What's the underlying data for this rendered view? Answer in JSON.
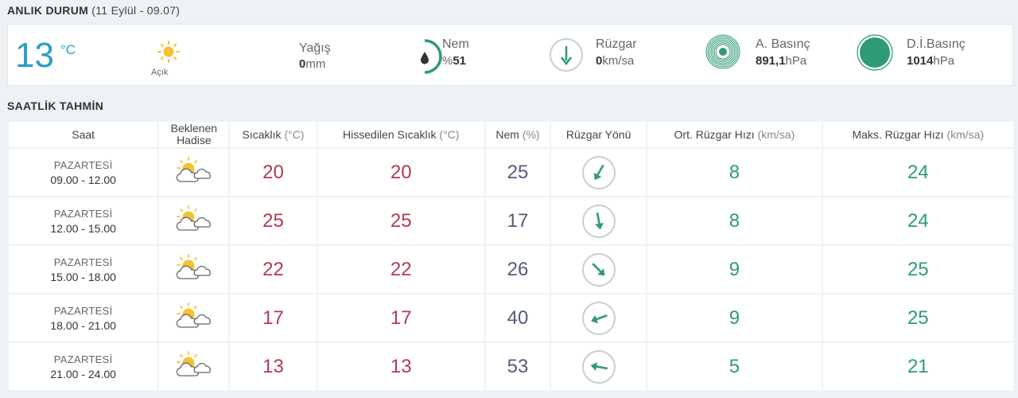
{
  "current": {
    "title": "ANLIK DURUM",
    "subtitle": "(11 Eylül - 09.07)",
    "temperature": "13",
    "temperature_unit": "°C",
    "condition_icon": "sun-icon",
    "condition": "Açık",
    "rain_label": "Yağış",
    "rain_value": "0",
    "rain_unit": "mm",
    "humidity_label": "Nem",
    "humidity_prefix": "%",
    "humidity_value": "51",
    "humidity_level": 0.51,
    "wind_label": "Rüzgar",
    "wind_value": "0",
    "wind_unit": "km/sa",
    "pressure_label": "A. Basınç",
    "pressure_value": "891,1",
    "pressure_unit": "hPa",
    "sea_pressure_label": "D.İ.Basınç",
    "sea_pressure_value": "1014",
    "sea_pressure_unit": "hPa"
  },
  "hourly": {
    "title": "SAATLİK TAHMİN",
    "headers": {
      "time": "Saat",
      "event_1": "Beklenen",
      "event_2": "Hadise",
      "temp": "Sıcaklık",
      "temp_unit": "(°C)",
      "feels": "Hissedilen Sıcaklık",
      "feels_unit": "(°C)",
      "humidity": "Nem",
      "humidity_unit": "(%)",
      "wind_dir": "Rüzgar Yönü",
      "wind_avg": "Ort. Rüzgar Hızı",
      "wind_avg_unit": "(km/sa)",
      "wind_max": "Maks. Rüzgar Hızı",
      "wind_max_unit": "(km/sa)"
    },
    "rows": [
      {
        "day": "PAZARTESİ",
        "range": "09.00 - 12.00",
        "icon": "partly-cloudy-icon",
        "temp": "20",
        "feels": "20",
        "humidity": "25",
        "wind_dir_deg": 30,
        "wind_avg": "8",
        "wind_max": "24"
      },
      {
        "day": "PAZARTESİ",
        "range": "12.00 - 15.00",
        "icon": "partly-cloudy-icon",
        "temp": "25",
        "feels": "25",
        "humidity": "17",
        "wind_dir_deg": 350,
        "wind_avg": "8",
        "wind_max": "24"
      },
      {
        "day": "PAZARTESİ",
        "range": "15.00 - 18.00",
        "icon": "partly-cloudy-icon",
        "temp": "22",
        "feels": "22",
        "humidity": "26",
        "wind_dir_deg": 315,
        "wind_avg": "9",
        "wind_max": "25"
      },
      {
        "day": "PAZARTESİ",
        "range": "18.00 - 21.00",
        "icon": "partly-cloudy-icon",
        "temp": "17",
        "feels": "17",
        "humidity": "40",
        "wind_dir_deg": 70,
        "wind_avg": "9",
        "wind_max": "25"
      },
      {
        "day": "PAZARTESİ",
        "range": "21.00 - 24.00",
        "icon": "partly-cloudy-icon",
        "temp": "13",
        "feels": "13",
        "humidity": "53",
        "wind_dir_deg": 100,
        "wind_avg": "5",
        "wind_max": "21"
      }
    ]
  },
  "colors": {
    "temp_blue": "#2a9fc5",
    "accent_green": "#2e9b74",
    "temp_red": "#b33a50",
    "humidity_purple": "#555a7a",
    "sun_yellow": "#f5c233"
  }
}
